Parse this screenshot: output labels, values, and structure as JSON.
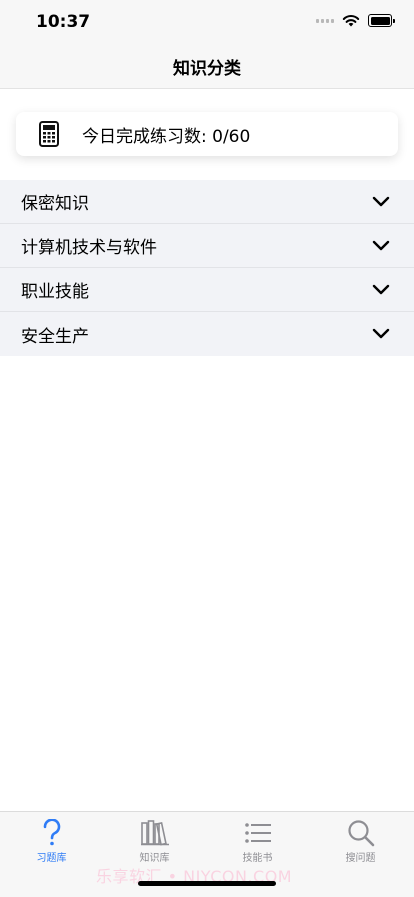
{
  "status_bar": {
    "time": "10:37"
  },
  "nav": {
    "title": "知识分类"
  },
  "summary": {
    "text": "今日完成练习数: 0/60",
    "icon": "calculator-icon"
  },
  "categories": [
    {
      "label": "保密知识"
    },
    {
      "label": "计算机技术与软件"
    },
    {
      "label": "职业技能"
    },
    {
      "label": "安全生产"
    }
  ],
  "tabs": [
    {
      "label": "习题库",
      "icon": "question-icon",
      "active": true
    },
    {
      "label": "知识库",
      "icon": "books-icon",
      "active": false
    },
    {
      "label": "技能书",
      "icon": "list-icon",
      "active": false
    },
    {
      "label": "搜问题",
      "icon": "search-icon",
      "active": false
    }
  ],
  "watermark": "乐享软汇 • NIYCON.COM",
  "colors": {
    "accent": "#2f7cf6",
    "inactive": "#8e8e93",
    "list_background": "#f2f3f7"
  }
}
